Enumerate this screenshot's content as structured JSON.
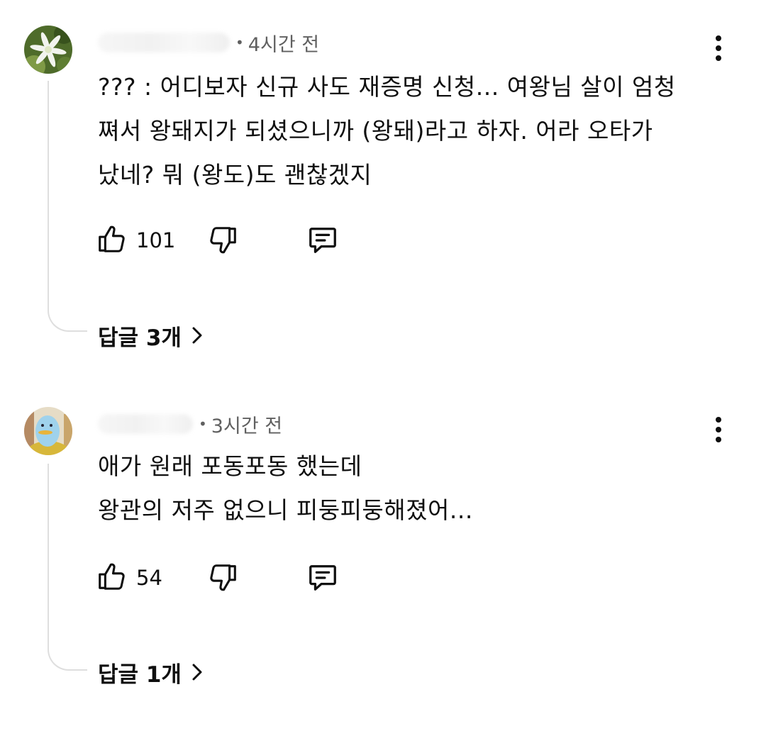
{
  "comments": [
    {
      "time": "4시간 전",
      "body_lines": [
        "??? : 어디보자 신규 사도 재증명 신청... 여왕님 살이 엄청",
        "쪄서 왕돼지가 되셨으니까 (왕돼)라고 하자. 어라 오타가",
        "났네? 뭐 (왕도)도 괜찮겠지"
      ],
      "like_count": "101",
      "replies_label": "답글 3개",
      "avatar_icon": "flower-avatar-icon"
    },
    {
      "time": "3시간 전",
      "body_lines": [
        "애가 원래 포동포동 했는데",
        "왕관의 저주 없으니 피둥피둥해졌어..."
      ],
      "like_count": "54",
      "replies_label": "답글 1개",
      "avatar_icon": "cartoon-character-avatar-icon"
    }
  ]
}
